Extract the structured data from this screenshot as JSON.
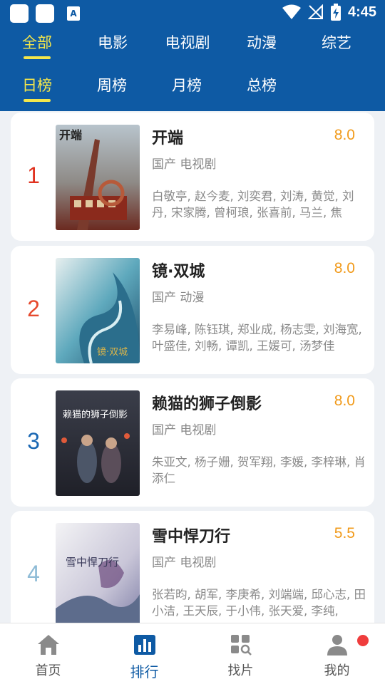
{
  "status_bar": {
    "time": "4:45",
    "sb_icon_a": "A"
  },
  "tabs_primary": [
    {
      "label": "全部",
      "active": true
    },
    {
      "label": "电影",
      "active": false
    },
    {
      "label": "电视剧",
      "active": false
    },
    {
      "label": "动漫",
      "active": false
    },
    {
      "label": "综艺",
      "active": false
    }
  ],
  "tabs_secondary": [
    {
      "label": "日榜",
      "active": true
    },
    {
      "label": "周榜",
      "active": false
    },
    {
      "label": "月榜",
      "active": false
    },
    {
      "label": "总榜",
      "active": false
    }
  ],
  "rank_colors": [
    "#e0321f",
    "#e64a2e",
    "#1a67b3",
    "#8ebbd6"
  ],
  "accent": "#0e5aa4",
  "score_color": "#f19a1a",
  "items": [
    {
      "rank": "1",
      "title": "开端",
      "score": "8.0",
      "meta": "国产 电视剧",
      "cast": "白敬亭, 赵今麦, 刘奕君, 刘涛, 黄觉, 刘丹, 宋家腾, 曾柯琅, 张喜前, 马兰, 焦",
      "poster_title": "开端"
    },
    {
      "rank": "2",
      "title": "镜·双城",
      "score": "8.0",
      "meta": "国产 动漫",
      "cast": "李易峰, 陈钰琪, 郑业成, 杨志雯, 刘海宽, 叶盛佳, 刘畅, 谭凯, 王媛可, 汤梦佳",
      "poster_title": "镜·双城"
    },
    {
      "rank": "3",
      "title": "赖猫的狮子倒影",
      "score": "8.0",
      "meta": "国产 电视剧",
      "cast": "朱亚文, 杨子姗, 贺军翔, 李媛, 李梓琳, 肖添仁",
      "poster_title": "赖猫的狮子倒影"
    },
    {
      "rank": "4",
      "title": "雪中悍刀行",
      "score": "5.5",
      "meta": "国产 电视剧",
      "cast": "张若昀, 胡军, 李庚希, 刘端端, 邱心志, 田小洁, 王天辰, 于小伟, 张天爱, 李纯,",
      "poster_title": "雪中悍刀行"
    }
  ],
  "bottom_nav": [
    {
      "label": "首页",
      "icon": "home-icon",
      "active": false
    },
    {
      "label": "排行",
      "icon": "ranking-icon",
      "active": true
    },
    {
      "label": "找片",
      "icon": "find-icon",
      "active": false
    },
    {
      "label": "我的",
      "icon": "profile-icon",
      "active": false
    }
  ]
}
